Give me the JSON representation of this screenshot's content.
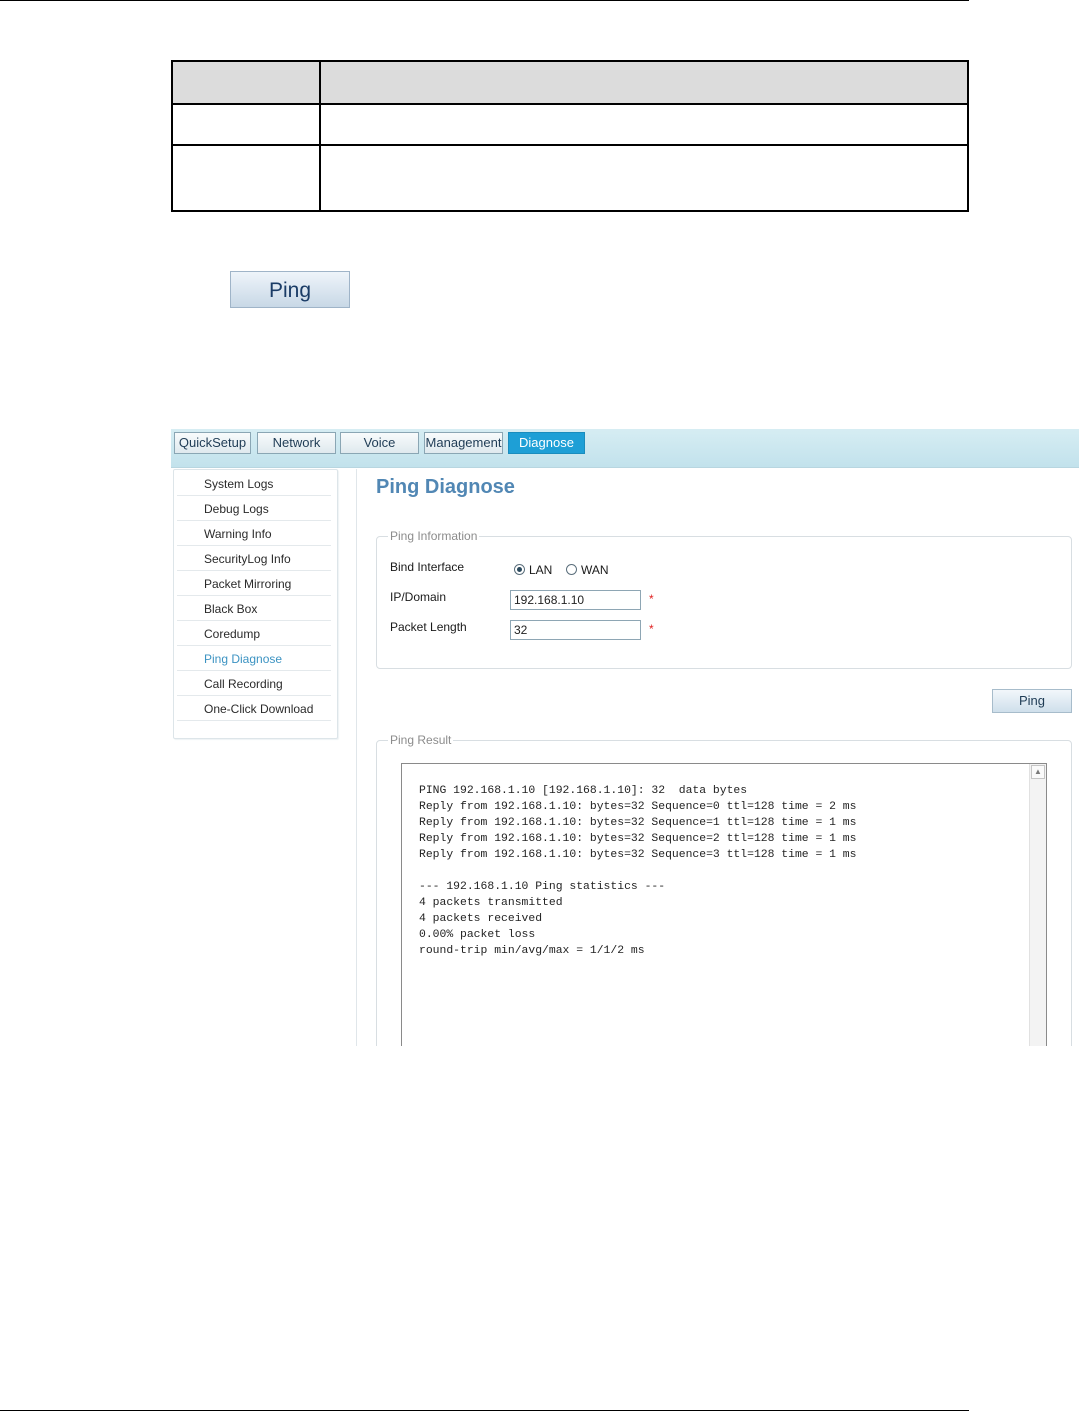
{
  "document": {
    "table": {
      "header": [
        "",
        ""
      ],
      "rows": [
        [
          "",
          ""
        ],
        [
          "",
          ""
        ]
      ]
    },
    "ping_button_label": "Ping"
  },
  "ui": {
    "tabs": [
      {
        "label": "QuickSetup",
        "active": false
      },
      {
        "label": "Network",
        "active": false
      },
      {
        "label": "Voice",
        "active": false
      },
      {
        "label": "Management",
        "active": false
      },
      {
        "label": "Diagnose",
        "active": true
      }
    ],
    "sidebar": {
      "items": [
        {
          "label": "System Logs"
        },
        {
          "label": "Debug Logs"
        },
        {
          "label": "Warning Info"
        },
        {
          "label": "SecurityLog Info"
        },
        {
          "label": "Packet Mirroring"
        },
        {
          "label": "Black Box"
        },
        {
          "label": "Coredump"
        },
        {
          "label": "Ping Diagnose",
          "active": true
        },
        {
          "label": "Call Recording"
        },
        {
          "label": "One-Click Download"
        }
      ]
    },
    "page_title": "Ping Diagnose",
    "ping_info": {
      "legend": "Ping Information",
      "bind_interface_label": "Bind Interface",
      "lan_label": "LAN",
      "wan_label": "WAN",
      "selected_interface": "LAN",
      "ip_domain_label": "IP/Domain",
      "ip_domain_value": "192.168.1.10",
      "packet_length_label": "Packet Length",
      "packet_length_value": "32",
      "required_mark": "*"
    },
    "ping_button_label": "Ping",
    "ping_result": {
      "legend": "Ping Result",
      "output": "PING 192.168.1.10 [192.168.1.10]: 32  data bytes\nReply from 192.168.1.10: bytes=32 Sequence=0 ttl=128 time = 2 ms\nReply from 192.168.1.10: bytes=32 Sequence=1 ttl=128 time = 1 ms\nReply from 192.168.1.10: bytes=32 Sequence=2 ttl=128 time = 1 ms\nReply from 192.168.1.10: bytes=32 Sequence=3 ttl=128 time = 1 ms\n\n--- 192.168.1.10 Ping statistics ---\n4 packets transmitted\n4 packets received\n0.00% packet loss\nround-trip min/avg/max = 1/1/2 ms"
    }
  }
}
